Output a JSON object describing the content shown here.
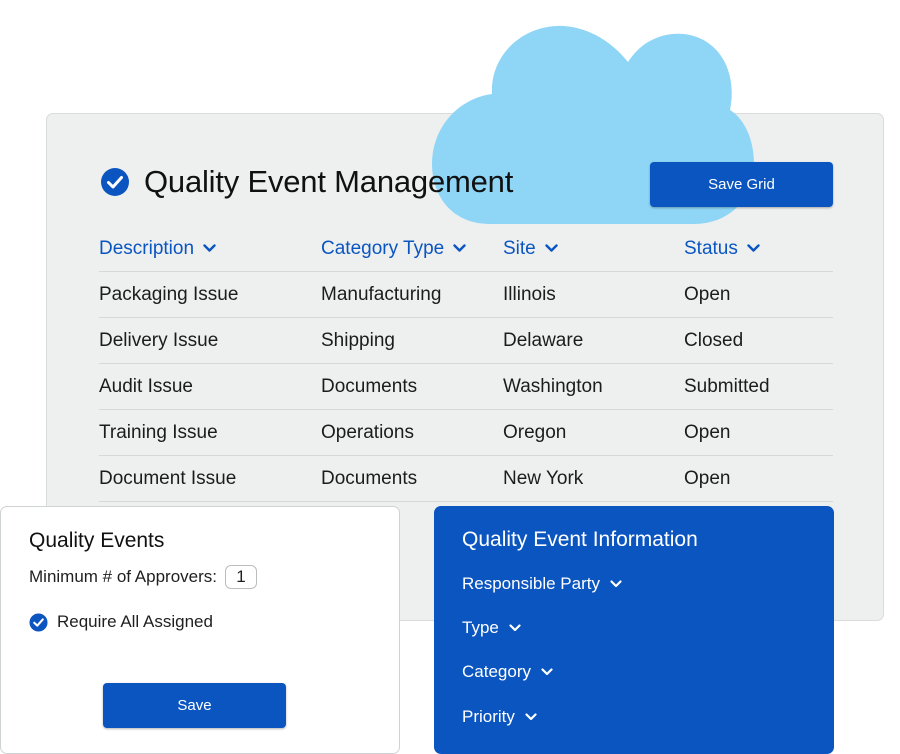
{
  "colors": {
    "brand_blue": "#0b55c0",
    "cloud": "#8fd6f6",
    "card_bg": "#eef0f0"
  },
  "main": {
    "title": "Quality Event Management",
    "save_grid_label": "Save Grid",
    "columns": [
      "Description",
      "Category Type",
      "Site",
      "Status"
    ],
    "rows": [
      [
        "Packaging Issue",
        "Manufacturing",
        "Illinois",
        "Open"
      ],
      [
        "Delivery Issue",
        "Shipping",
        "Delaware",
        "Closed"
      ],
      [
        "Audit Issue",
        "Documents",
        "Washington",
        "Submitted"
      ],
      [
        "Training Issue",
        "Operations",
        "Oregon",
        "Open"
      ],
      [
        "Document Issue",
        "Documents",
        "New York",
        "Open"
      ]
    ]
  },
  "quality_events": {
    "title": "Quality Events",
    "approvers_label": "Minimum # of Approvers:",
    "approvers_value": "1",
    "require_label": "Require All Assigned",
    "save_label": "Save"
  },
  "info": {
    "title": "Quality Event Information",
    "items": [
      "Responsible Party",
      "Type",
      "Category",
      "Priority"
    ]
  }
}
